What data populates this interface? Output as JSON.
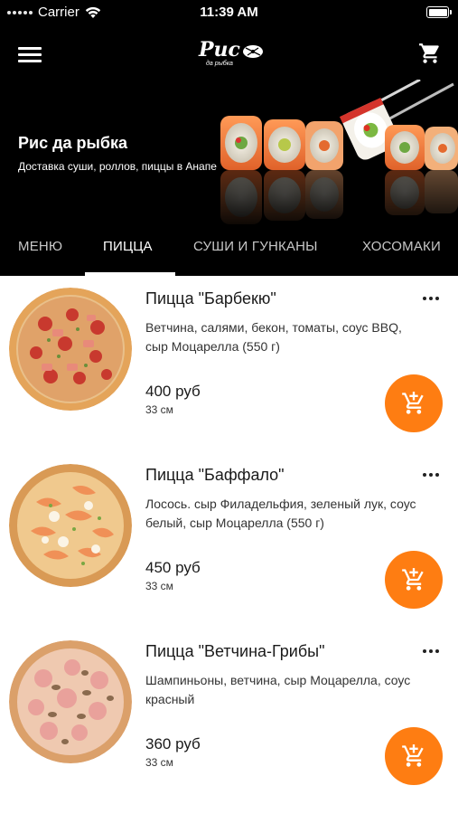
{
  "status_bar": {
    "carrier": "Carrier",
    "time": "11:39 AM"
  },
  "header": {
    "logo_text": "Рис",
    "logo_sub": "да рыбка",
    "title": "Рис да рыбка",
    "subtitle": "Доставка суши, роллов, пиццы в Анапе"
  },
  "tabs": [
    {
      "label": "МЕНЮ",
      "active": false
    },
    {
      "label": "ПИЦЦА",
      "active": true
    },
    {
      "label": "СУШИ И ГУНКАНЫ",
      "active": false
    },
    {
      "label": "ХОСОМАКИ",
      "active": false
    }
  ],
  "items": [
    {
      "name": "Пицца \"Барбекю\"",
      "description": "Ветчина, салями, бекон, томаты, соус BBQ, сыр Моцарелла (550 г)",
      "price": "400 руб",
      "size": "33 см"
    },
    {
      "name": "Пицца \"Баффало\"",
      "description": "Лосось. сыр Филадельфия, зеленый лук, соус белый, сыр Моцарелла (550 г)",
      "price": "450 руб",
      "size": "33 см"
    },
    {
      "name": "Пицца \"Ветчина-Грибы\"",
      "description": "Шампиньоны, ветчина, сыр Моцарелла, соус красный",
      "price": "360 руб",
      "size": "33 см"
    }
  ],
  "colors": {
    "accent": "#fe7d12",
    "header_bg": "#000000"
  },
  "icons": {
    "menu": "hamburger-icon",
    "cart": "cart-icon",
    "more": "more-dots-icon",
    "add_to_cart": "add-to-cart-icon"
  }
}
